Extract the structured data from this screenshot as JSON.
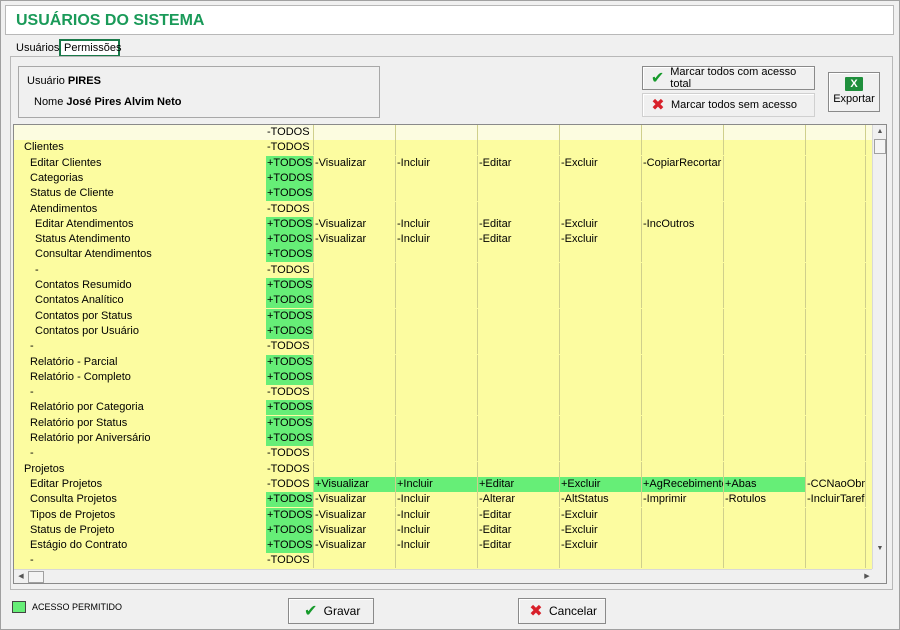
{
  "window": {
    "title": "USUÁRIOS DO SISTEMA"
  },
  "tabs": [
    {
      "label": "Usuários",
      "active": false
    },
    {
      "label": "Permissões",
      "active": true
    }
  ],
  "user": {
    "usuario_label": "Usuário",
    "usuario_value": "PIRES",
    "nome_label": "Nome",
    "nome_value": "José Pires Alvim Neto"
  },
  "actions": {
    "mark_all_full": "Marcar todos com acesso total",
    "mark_all_none": "Marcar todos sem acesso",
    "export": "Exportar"
  },
  "colors": {
    "granted": "#66ee77",
    "row_bg": "#fcfca0",
    "title": "#1a9a59"
  },
  "grid": {
    "rows": [
      {
        "name": "",
        "indent": 0,
        "todos": "-TODOS",
        "todos_on": false,
        "perms": []
      },
      {
        "name": "Clientes",
        "indent": 1,
        "todos": "-TODOS",
        "todos_on": false,
        "perms": []
      },
      {
        "name": "Editar Clientes",
        "indent": 2,
        "todos": "+TODOS",
        "todos_on": true,
        "perms": [
          {
            "t": "-Visualizar",
            "on": false
          },
          {
            "t": "-Incluir",
            "on": false
          },
          {
            "t": "-Editar",
            "on": false
          },
          {
            "t": "-Excluir",
            "on": false
          },
          {
            "t": "-CopiarRecortar",
            "on": false
          }
        ]
      },
      {
        "name": "Categorias",
        "indent": 2,
        "todos": "+TODOS",
        "todos_on": true,
        "perms": []
      },
      {
        "name": "Status de Cliente",
        "indent": 2,
        "todos": "+TODOS",
        "todos_on": true,
        "perms": []
      },
      {
        "name": "Atendimentos",
        "indent": 2,
        "todos": "-TODOS",
        "todos_on": false,
        "perms": []
      },
      {
        "name": "Editar Atendimentos",
        "indent": 3,
        "todos": "+TODOS",
        "todos_on": true,
        "perms": [
          {
            "t": "-Visualizar",
            "on": false
          },
          {
            "t": "-Incluir",
            "on": false
          },
          {
            "t": "-Editar",
            "on": false
          },
          {
            "t": "-Excluir",
            "on": false
          },
          {
            "t": "-IncOutros",
            "on": false
          }
        ]
      },
      {
        "name": "Status Atendimento",
        "indent": 3,
        "todos": "+TODOS",
        "todos_on": true,
        "perms": [
          {
            "t": "-Visualizar",
            "on": false
          },
          {
            "t": "-Incluir",
            "on": false
          },
          {
            "t": "-Editar",
            "on": false
          },
          {
            "t": "-Excluir",
            "on": false
          }
        ]
      },
      {
        "name": "Consultar Atendimentos",
        "indent": 3,
        "todos": "+TODOS",
        "todos_on": true,
        "perms": []
      },
      {
        "name": "-",
        "indent": 3,
        "todos": "-TODOS",
        "todos_on": false,
        "perms": []
      },
      {
        "name": "Contatos Resumido",
        "indent": 3,
        "todos": "+TODOS",
        "todos_on": true,
        "perms": []
      },
      {
        "name": "Contatos Analítico",
        "indent": 3,
        "todos": "+TODOS",
        "todos_on": true,
        "perms": []
      },
      {
        "name": "Contatos por Status",
        "indent": 3,
        "todos": "+TODOS",
        "todos_on": true,
        "perms": []
      },
      {
        "name": "Contatos por Usuário",
        "indent": 3,
        "todos": "+TODOS",
        "todos_on": true,
        "perms": []
      },
      {
        "name": "-",
        "indent": 2,
        "todos": "-TODOS",
        "todos_on": false,
        "perms": []
      },
      {
        "name": "Relatório - Parcial",
        "indent": 2,
        "todos": "+TODOS",
        "todos_on": true,
        "perms": []
      },
      {
        "name": "Relatório - Completo",
        "indent": 2,
        "todos": "+TODOS",
        "todos_on": true,
        "perms": []
      },
      {
        "name": "-",
        "indent": 2,
        "todos": "-TODOS",
        "todos_on": false,
        "perms": []
      },
      {
        "name": "Relatório por Categoria",
        "indent": 2,
        "todos": "+TODOS",
        "todos_on": true,
        "perms": []
      },
      {
        "name": "Relatório por Status",
        "indent": 2,
        "todos": "+TODOS",
        "todos_on": true,
        "perms": []
      },
      {
        "name": "Relatório por Aniversário",
        "indent": 2,
        "todos": "+TODOS",
        "todos_on": true,
        "perms": []
      },
      {
        "name": "-",
        "indent": 2,
        "todos": "-TODOS",
        "todos_on": false,
        "perms": []
      },
      {
        "name": "Projetos",
        "indent": 1,
        "todos": "-TODOS",
        "todos_on": false,
        "perms": []
      },
      {
        "name": "Editar Projetos",
        "indent": 2,
        "todos": "-TODOS",
        "todos_on": false,
        "perms": [
          {
            "t": "+Visualizar",
            "on": true
          },
          {
            "t": "+Incluir",
            "on": true
          },
          {
            "t": "+Editar",
            "on": true
          },
          {
            "t": "+Excluir",
            "on": true
          },
          {
            "t": "+AgRecebimentos",
            "on": true
          },
          {
            "t": "+Abas",
            "on": true
          },
          {
            "t": "-CCNaoObrigatorio",
            "on": false
          }
        ]
      },
      {
        "name": "Consulta Projetos",
        "indent": 2,
        "todos": "+TODOS",
        "todos_on": true,
        "perms": [
          {
            "t": "-Visualizar",
            "on": false
          },
          {
            "t": "-Incluir",
            "on": false
          },
          {
            "t": "-Alterar",
            "on": false
          },
          {
            "t": "-AltStatus",
            "on": false
          },
          {
            "t": "-Imprimir",
            "on": false
          },
          {
            "t": "-Rotulos",
            "on": false
          },
          {
            "t": "-IncluirTarefa",
            "on": false
          }
        ]
      },
      {
        "name": "Tipos de Projetos",
        "indent": 2,
        "todos": "+TODOS",
        "todos_on": true,
        "perms": [
          {
            "t": "-Visualizar",
            "on": false
          },
          {
            "t": "-Incluir",
            "on": false
          },
          {
            "t": "-Editar",
            "on": false
          },
          {
            "t": "-Excluir",
            "on": false
          }
        ]
      },
      {
        "name": "Status de Projeto",
        "indent": 2,
        "todos": "+TODOS",
        "todos_on": true,
        "perms": [
          {
            "t": "-Visualizar",
            "on": false
          },
          {
            "t": "-Incluir",
            "on": false
          },
          {
            "t": "-Editar",
            "on": false
          },
          {
            "t": "-Excluir",
            "on": false
          }
        ]
      },
      {
        "name": "Estágio do Contrato",
        "indent": 2,
        "todos": "+TODOS",
        "todos_on": true,
        "perms": [
          {
            "t": "-Visualizar",
            "on": false
          },
          {
            "t": "-Incluir",
            "on": false
          },
          {
            "t": "-Editar",
            "on": false
          },
          {
            "t": "-Excluir",
            "on": false
          }
        ]
      },
      {
        "name": "-",
        "indent": 2,
        "todos": "-TODOS",
        "todos_on": false,
        "perms": []
      }
    ]
  },
  "legend": {
    "label": "ACESSO PERMITIDO"
  },
  "footer": {
    "save": "Gravar",
    "cancel": "Cancelar"
  },
  "icons": {
    "check": "check-icon",
    "cross": "cross-icon",
    "excel": "excel-icon"
  }
}
